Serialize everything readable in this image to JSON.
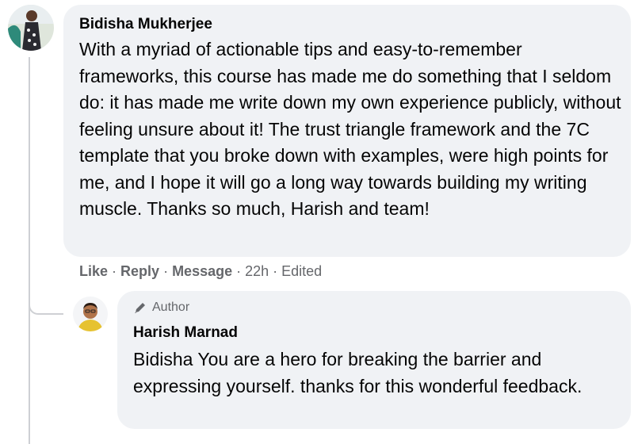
{
  "comment": {
    "author": "Bidisha Mukherjee",
    "text": "With a myriad of actionable tips and easy-to-remember frameworks, this course has made me do something that I seldom do: it has made me write down my own experience publicly, without feeling unsure about it! The trust triangle framework and the 7C template that you broke down with examples, were high points for me, and I hope it will go a long way towards building my writing muscle. Thanks so much, Harish and team!",
    "actions": {
      "like": "Like",
      "reply": "Reply",
      "message": "Message",
      "separator": "·",
      "time": "22h",
      "edited": "Edited"
    }
  },
  "reply": {
    "badge": "Author",
    "badge_icon": "pencil-icon",
    "author": "Harish Marnad",
    "text": "Bidisha You are a hero for breaking the barrier and expressing yourself. thanks for this wonderful feedback."
  },
  "colors": {
    "bubble": "#f0f2f5",
    "secondary_text": "#65676b",
    "primary_text": "#050505",
    "thread_line": "#ced0d4"
  }
}
